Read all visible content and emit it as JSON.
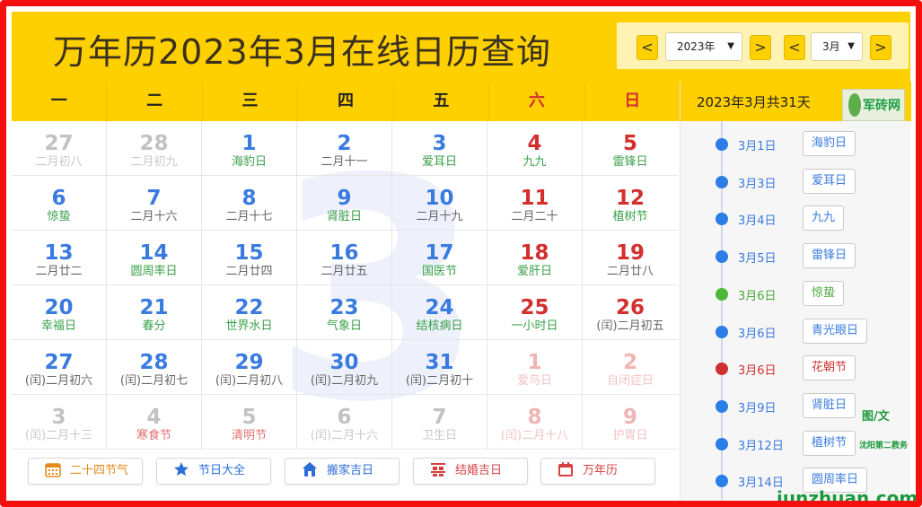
{
  "header": {
    "title": "万年历2023年3月在线日历查询",
    "year_select": "2023年",
    "month_select": "3月",
    "prev_year": "<",
    "next_year": ">",
    "prev_month": "<",
    "next_month": ">"
  },
  "weekdays": [
    "一",
    "二",
    "三",
    "四",
    "五",
    "六",
    "日"
  ],
  "background_numeral": "3",
  "days": [
    {
      "d": "27",
      "l": "二月初八",
      "s": "grey",
      "lc": ""
    },
    {
      "d": "28",
      "l": "二月初九",
      "s": "grey",
      "lc": ""
    },
    {
      "d": "1",
      "l": "海豹日",
      "s": "blue",
      "lc": "green"
    },
    {
      "d": "2",
      "l": "二月十一",
      "s": "blue",
      "lc": ""
    },
    {
      "d": "3",
      "l": "爱耳日",
      "s": "blue",
      "lc": "green"
    },
    {
      "d": "4",
      "l": "九九",
      "s": "red",
      "lc": "green"
    },
    {
      "d": "5",
      "l": "雷锋日",
      "s": "red",
      "lc": "green"
    },
    {
      "d": "6",
      "l": "惊蛰",
      "s": "blue",
      "lc": "green"
    },
    {
      "d": "7",
      "l": "二月十六",
      "s": "blue",
      "lc": ""
    },
    {
      "d": "8",
      "l": "二月十七",
      "s": "blue",
      "lc": ""
    },
    {
      "d": "9",
      "l": "肾脏日",
      "s": "blue",
      "lc": "green"
    },
    {
      "d": "10",
      "l": "二月十九",
      "s": "blue",
      "lc": ""
    },
    {
      "d": "11",
      "l": "二月二十",
      "s": "red",
      "lc": ""
    },
    {
      "d": "12",
      "l": "植树节",
      "s": "red",
      "lc": "green"
    },
    {
      "d": "13",
      "l": "二月廿二",
      "s": "blue",
      "lc": ""
    },
    {
      "d": "14",
      "l": "圆周率日",
      "s": "blue",
      "lc": "green"
    },
    {
      "d": "15",
      "l": "二月廿四",
      "s": "blue",
      "lc": ""
    },
    {
      "d": "16",
      "l": "二月廿五",
      "s": "blue",
      "lc": ""
    },
    {
      "d": "17",
      "l": "国医节",
      "s": "blue",
      "lc": "green"
    },
    {
      "d": "18",
      "l": "爱肝日",
      "s": "red",
      "lc": "green"
    },
    {
      "d": "19",
      "l": "二月廿八",
      "s": "red",
      "lc": ""
    },
    {
      "d": "20",
      "l": "幸福日",
      "s": "blue",
      "lc": "green"
    },
    {
      "d": "21",
      "l": "春分",
      "s": "blue",
      "lc": "green"
    },
    {
      "d": "22",
      "l": "世界水日",
      "s": "blue",
      "lc": "green"
    },
    {
      "d": "23",
      "l": "气象日",
      "s": "blue",
      "lc": "green"
    },
    {
      "d": "24",
      "l": "结核病日",
      "s": "blue",
      "lc": "green"
    },
    {
      "d": "25",
      "l": "一小时日",
      "s": "red",
      "lc": "green"
    },
    {
      "d": "26",
      "l": "(闰)二月初五",
      "s": "red",
      "lc": ""
    },
    {
      "d": "27",
      "l": "(闰)二月初六",
      "s": "blue",
      "lc": ""
    },
    {
      "d": "28",
      "l": "(闰)二月初七",
      "s": "blue",
      "lc": ""
    },
    {
      "d": "29",
      "l": "(闰)二月初八",
      "s": "blue",
      "lc": ""
    },
    {
      "d": "30",
      "l": "(闰)二月初九",
      "s": "blue",
      "lc": ""
    },
    {
      "d": "31",
      "l": "(闰)二月初十",
      "s": "blue",
      "lc": ""
    },
    {
      "d": "1",
      "l": "爱鸟日",
      "s": "fred",
      "lc": ""
    },
    {
      "d": "2",
      "l": "自闭症日",
      "s": "fred",
      "lc": ""
    },
    {
      "d": "3",
      "l": "(闰)二月十三",
      "s": "grey",
      "lc": ""
    },
    {
      "d": "4",
      "l": "寒食节",
      "s": "grey",
      "lc": "red"
    },
    {
      "d": "5",
      "l": "清明节",
      "s": "grey",
      "lc": "red"
    },
    {
      "d": "6",
      "l": "(闰)二月十六",
      "s": "grey",
      "lc": ""
    },
    {
      "d": "7",
      "l": "卫生日",
      "s": "grey",
      "lc": ""
    },
    {
      "d": "8",
      "l": "(闰)二月十八",
      "s": "fred",
      "lc": ""
    },
    {
      "d": "9",
      "l": "护胃日",
      "s": "fred",
      "lc": ""
    }
  ],
  "bottom_buttons": [
    {
      "label": "二十四节气",
      "color": "#e58a1a",
      "icon": "calendar-grid-icon"
    },
    {
      "label": "节日大全",
      "color": "#2b6fd6",
      "icon": "star-icon"
    },
    {
      "label": "搬家吉日",
      "color": "#2b6fd6",
      "icon": "house-icon"
    },
    {
      "label": "结婚吉日",
      "color": "#d64040",
      "icon": "double-happiness-icon"
    },
    {
      "label": "万年历",
      "color": "#d64040",
      "icon": "calendar-icon"
    }
  ],
  "sidebar": {
    "title": "2023年3月共31天",
    "logo_text": "军砖网",
    "events": [
      {
        "date": "3月1日",
        "name": "海豹日",
        "c": "b"
      },
      {
        "date": "3月3日",
        "name": "爱耳日",
        "c": "b"
      },
      {
        "date": "3月4日",
        "name": "九九",
        "c": "b"
      },
      {
        "date": "3月5日",
        "name": "雷锋日",
        "c": "b"
      },
      {
        "date": "3月6日",
        "name": "惊蛰",
        "c": "g"
      },
      {
        "date": "3月6日",
        "name": "青光眼日",
        "c": "b"
      },
      {
        "date": "3月6日",
        "name": "花朝节",
        "c": "r"
      },
      {
        "date": "3月9日",
        "name": "肾脏日",
        "c": "b"
      },
      {
        "date": "3月12日",
        "name": "植树节",
        "c": "b"
      },
      {
        "date": "3月14日",
        "name": "圆周率日",
        "c": "b"
      }
    ]
  },
  "watermark": {
    "credit": "图/文",
    "author": "沈阳第二教务",
    "site": "junzhuan.com"
  }
}
